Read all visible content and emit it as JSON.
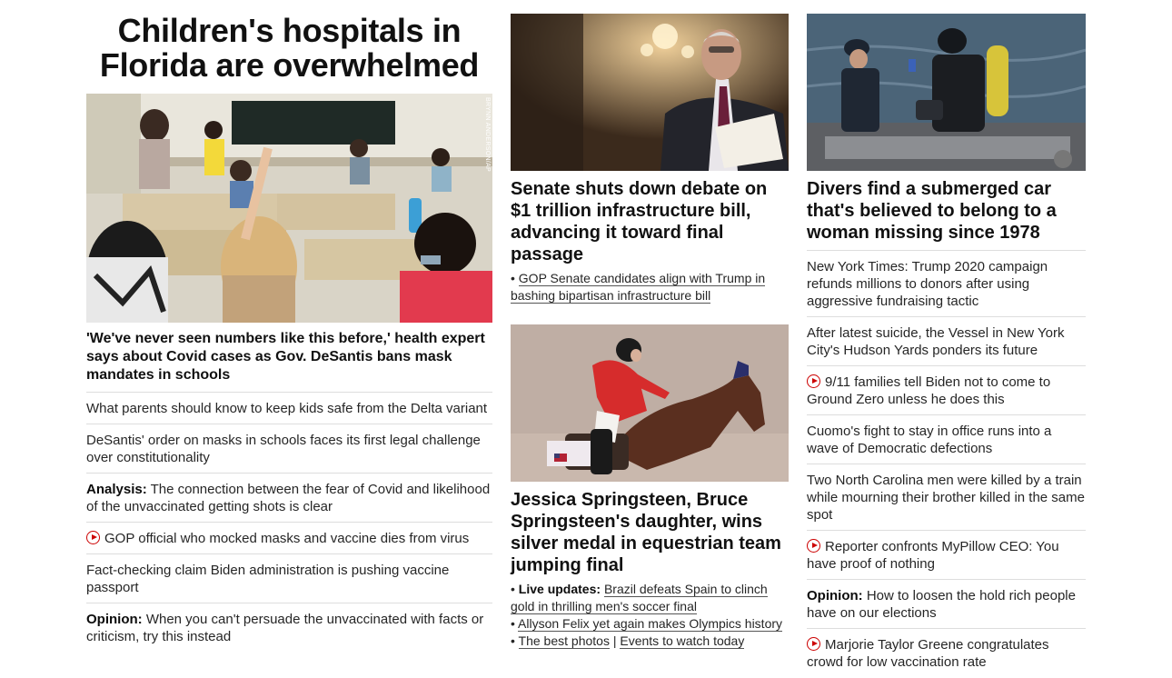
{
  "lead": {
    "title": "Children's hospitals in Florida are overwhelmed",
    "photo_credit": "BRYNN ANDERSON/AP",
    "headline": "'We've never seen numbers like this before,' health expert says about Covid cases as Gov. DeSantis bans mask mandates in schools",
    "links": [
      {
        "label": "",
        "text": "What parents should know to keep kids safe from the Delta variant",
        "video": false
      },
      {
        "label": "",
        "text": "DeSantis' order on masks in schools faces its first legal challenge over constitutionality",
        "video": false
      },
      {
        "label": "Analysis:",
        "text": " The connection between the fear of Covid and likelihood of the unvaccinated getting shots is clear",
        "video": false
      },
      {
        "label": "",
        "text": "GOP official who mocked masks and vaccine dies from virus",
        "video": true
      },
      {
        "label": "",
        "text": "Fact-checking claim Biden administration is pushing vaccine passport",
        "video": false
      },
      {
        "label": "Opinion:",
        "text": " When you can't persuade the unvaccinated with facts or criticism, try this instead",
        "video": false
      }
    ]
  },
  "senate": {
    "headline": "Senate shuts down debate on $1 trillion infrastructure bill, advancing it toward final passage",
    "bullet": "GOP Senate candidates align with Trump in bashing bipartisan infrastructure bill"
  },
  "olympics": {
    "headline": "Jessica Springsteen, Bruce Springsteen's daughter, wins silver medal in equestrian team jumping final",
    "live_label": "Live updates:",
    "live_text": "Brazil defeats Spain to clinch gold in thrilling men's soccer final",
    "bullet2": "Allyson Felix yet again makes Olympics history",
    "photos": "The best photos",
    "separator": "|",
    "events": "Events to watch today",
    "bullet_char": "•"
  },
  "divers": {
    "headline": "Divers find a submerged car that's believed to belong to a woman missing since 1978",
    "links": [
      {
        "label": "",
        "text": "New York Times: Trump 2020 campaign refunds millions to donors after using aggressive fundraising tactic",
        "video": false
      },
      {
        "label": "",
        "text": "After latest suicide, the Vessel in New York City's Hudson Yards ponders its future",
        "video": false
      },
      {
        "label": "",
        "text": "9/11 families tell Biden not to come to Ground Zero unless he does this",
        "video": true
      },
      {
        "label": "",
        "text": "Cuomo's fight to stay in office runs into a wave of Democratic defections",
        "video": false
      },
      {
        "label": "",
        "text": "Two North Carolina men were killed by a train while mourning their brother killed in the same spot",
        "video": false
      },
      {
        "label": "",
        "text": "Reporter confronts MyPillow CEO: You have proof of nothing",
        "video": true
      },
      {
        "label": "Opinion:",
        "text": " How to loosen the hold rich people have on our elections",
        "video": false
      },
      {
        "label": "",
        "text": "Marjorie Taylor Greene congratulates crowd for low vaccination rate",
        "video": true
      }
    ]
  },
  "colors": {
    "accent": "#cc0000",
    "divider": "#dddddd",
    "text": "#0c0c0c"
  }
}
